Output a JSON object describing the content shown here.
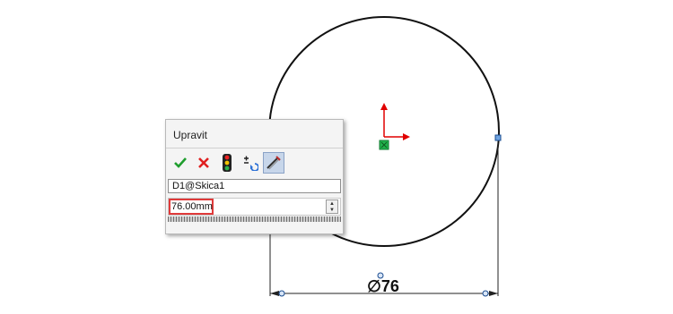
{
  "dialog": {
    "title": "Upravit",
    "toolbar": {
      "ok_icon": "checkmark-icon",
      "cancel_icon": "x-icon",
      "rebuild_icon": "traffic-light-icon",
      "reverse_icon": "plus-minus-reverse-icon",
      "mark_icon": "mark-dimension-icon"
    },
    "dimension_name": "D1@Skica1",
    "dimension_value": "76.00mm",
    "accent_color": "#e03a3a"
  },
  "sketch": {
    "dimension_label": "∅76",
    "origin_color": "#e00000",
    "center_point_color": "#22b24c"
  }
}
